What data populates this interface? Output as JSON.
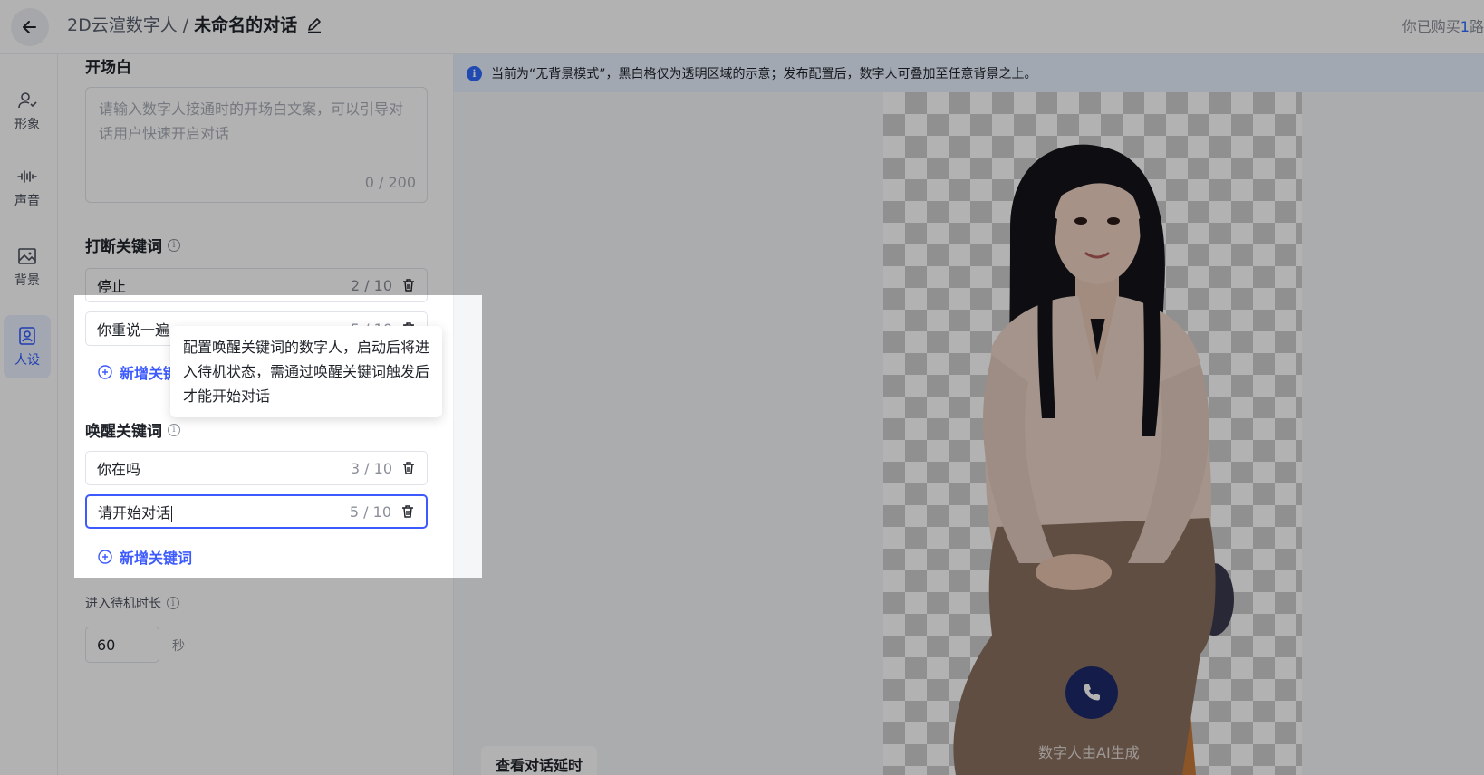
{
  "header": {
    "breadcrumb_parent": "2D云渲数字人",
    "breadcrumb_sep": "/",
    "title": "未命名的对话",
    "purchase_prefix": "你已购买",
    "purchase_count": "1",
    "purchase_suffix": "路"
  },
  "rail": {
    "items": [
      {
        "label": "形象",
        "icon": "person-icon"
      },
      {
        "label": "声音",
        "icon": "audio-wave-icon"
      },
      {
        "label": "背景",
        "icon": "image-icon"
      },
      {
        "label": "人设",
        "icon": "persona-icon",
        "active": true
      }
    ]
  },
  "opening": {
    "title_partial": "开场白",
    "placeholder": "请输入数字人接通时的开场白文案，可以引导对话用户快速开启对话",
    "counter": "0 / 200"
  },
  "interrupt": {
    "title": "打断关键词",
    "items": [
      {
        "text": "停止",
        "count": "2 / 10"
      },
      {
        "text": "你重说一遍",
        "count": "5 / 10"
      }
    ],
    "add_label": "新增关键词"
  },
  "wake": {
    "title": "唤醒关键词",
    "items": [
      {
        "text": "你在吗",
        "count": "3 / 10"
      },
      {
        "text": "请开始对话",
        "count": "5 / 10"
      }
    ],
    "add_label": "新增关键词",
    "tooltip": "配置唤醒关键词的数字人，启动后将进入待机状态，需通过唤醒关键词触发后才能开始对话"
  },
  "standby": {
    "label": "进入待机时长",
    "value": "60",
    "unit": "秒"
  },
  "preview": {
    "notice": "当前为“无背景模式”，黑白格仅为透明区域的示意；发布配置后，数字人可叠加至任意背景之上。",
    "watermark": "数字人由AI生成",
    "delay_button": "查看对话延时"
  },
  "colors": {
    "accent": "#3d5afe",
    "notice_bg": "#e9f1ff",
    "call_button": "#1d2a6b"
  }
}
